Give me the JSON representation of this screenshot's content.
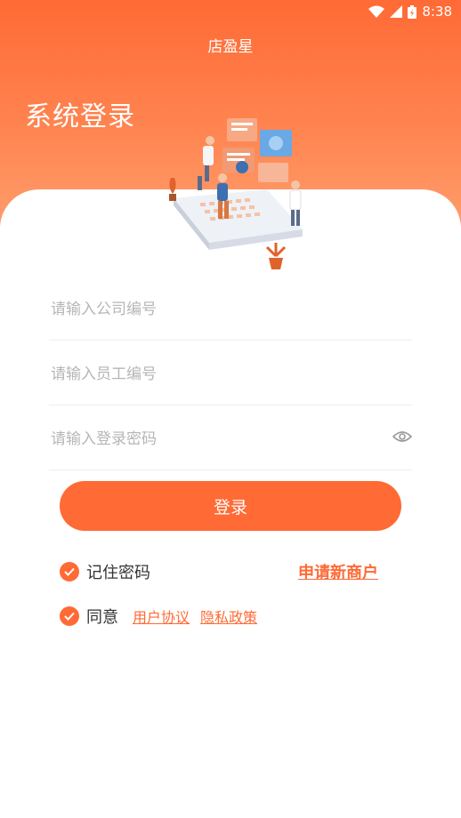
{
  "status_bar": {
    "time": "8:38"
  },
  "header": {
    "app_title": "店盈星",
    "heading": "系统登录"
  },
  "form": {
    "company_placeholder": "请输入公司编号",
    "employee_placeholder": "请输入员工编号",
    "password_placeholder": "请输入登录密码",
    "login_label": "登录"
  },
  "options": {
    "remember_label": "记住密码",
    "apply_label": "申请新商户",
    "agree_label": "同意",
    "user_agreement": "用户协议",
    "privacy_policy": "隐私政策"
  },
  "colors": {
    "accent": "#ff6a35",
    "header_gradient_end": "#ff9e6d"
  },
  "icons": [
    "wifi-icon",
    "signal-icon",
    "battery-icon",
    "eye-icon",
    "check-icon"
  ]
}
